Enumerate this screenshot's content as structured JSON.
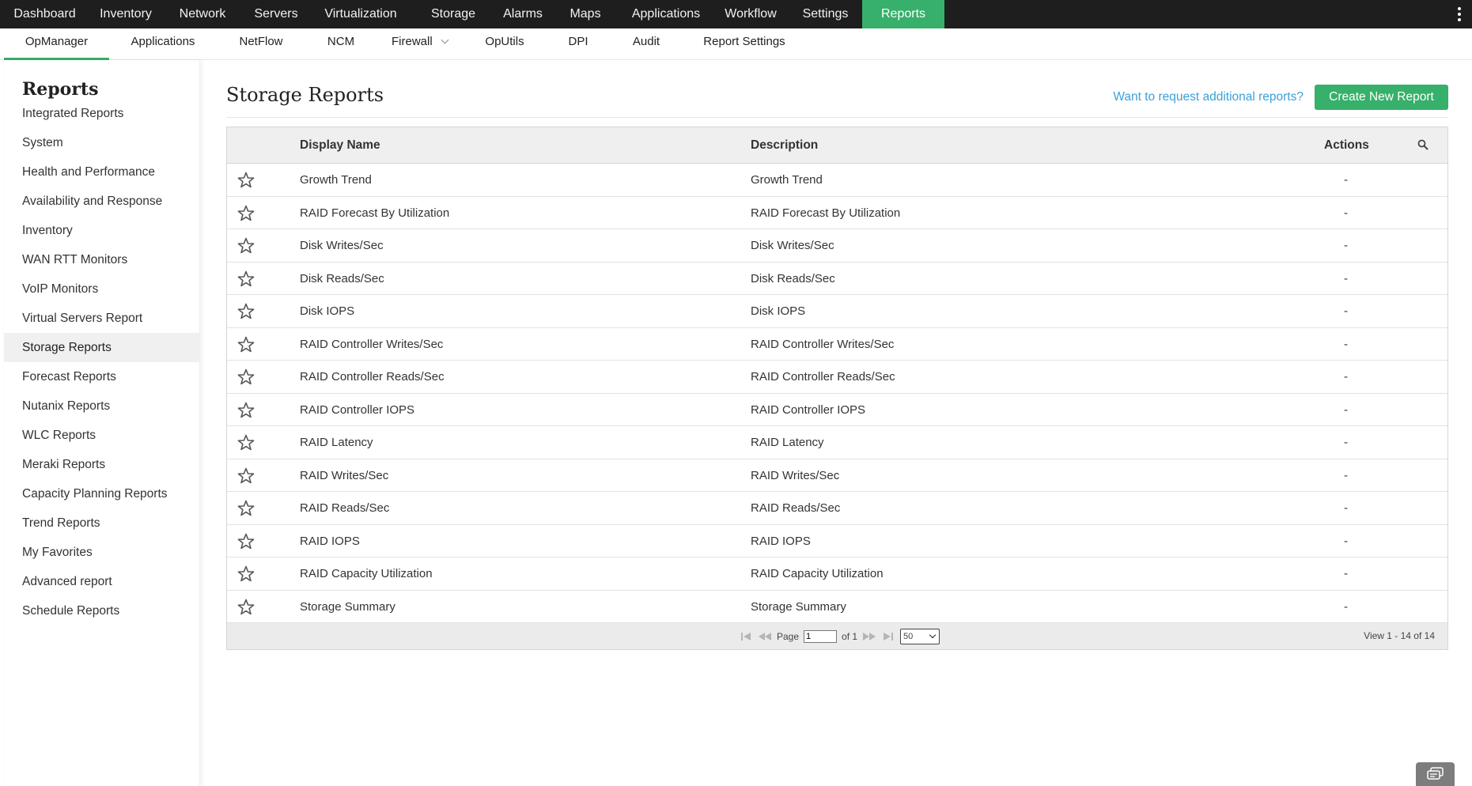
{
  "topnav": {
    "items": [
      {
        "label": "Dashboard"
      },
      {
        "label": "Inventory"
      },
      {
        "label": "Network"
      },
      {
        "label": "Servers"
      },
      {
        "label": "Virtualization"
      },
      {
        "label": "Storage"
      },
      {
        "label": "Alarms"
      },
      {
        "label": "Maps"
      },
      {
        "label": "Applications"
      },
      {
        "label": "Workflow"
      },
      {
        "label": "Settings"
      },
      {
        "label": "Reports"
      }
    ],
    "active": "Reports"
  },
  "subnav": {
    "items": [
      {
        "label": "OpManager"
      },
      {
        "label": "Applications"
      },
      {
        "label": "NetFlow"
      },
      {
        "label": "NCM"
      },
      {
        "label": "Firewall"
      },
      {
        "label": "OpUtils"
      },
      {
        "label": "DPI"
      },
      {
        "label": "Audit"
      },
      {
        "label": "Report Settings"
      }
    ],
    "active": "OpManager"
  },
  "sidebar": {
    "title": "Reports",
    "items": [
      {
        "label": "Integrated Reports"
      },
      {
        "label": "System"
      },
      {
        "label": "Health and Performance"
      },
      {
        "label": "Availability and Response"
      },
      {
        "label": "Inventory"
      },
      {
        "label": "WAN RTT Monitors"
      },
      {
        "label": "VoIP Monitors"
      },
      {
        "label": "Virtual Servers Report"
      },
      {
        "label": "Storage Reports"
      },
      {
        "label": "Forecast Reports"
      },
      {
        "label": "Nutanix Reports"
      },
      {
        "label": "WLC Reports"
      },
      {
        "label": "Meraki Reports"
      },
      {
        "label": "Capacity Planning Reports"
      },
      {
        "label": "Trend Reports"
      },
      {
        "label": "My Favorites"
      },
      {
        "label": "Advanced report"
      },
      {
        "label": "Schedule Reports"
      }
    ],
    "active": "Storage Reports"
  },
  "main": {
    "title": "Storage Reports",
    "request_link": "Want to request additional reports?",
    "create_button": "Create New Report",
    "table": {
      "columns": {
        "name": "Display Name",
        "description": "Description",
        "actions": "Actions"
      },
      "rows": [
        {
          "name": "Growth Trend",
          "description": "Growth Trend",
          "actions": "-"
        },
        {
          "name": "RAID Forecast By Utilization",
          "description": "RAID Forecast By Utilization",
          "actions": "-"
        },
        {
          "name": "Disk Writes/Sec",
          "description": "Disk Writes/Sec",
          "actions": "-"
        },
        {
          "name": "Disk Reads/Sec",
          "description": "Disk Reads/Sec",
          "actions": "-"
        },
        {
          "name": "Disk IOPS",
          "description": "Disk IOPS",
          "actions": "-"
        },
        {
          "name": "RAID Controller Writes/Sec",
          "description": "RAID Controller Writes/Sec",
          "actions": "-"
        },
        {
          "name": "RAID Controller Reads/Sec",
          "description": "RAID Controller Reads/Sec",
          "actions": "-"
        },
        {
          "name": "RAID Controller IOPS",
          "description": "RAID Controller IOPS",
          "actions": "-"
        },
        {
          "name": "RAID Latency",
          "description": "RAID Latency",
          "actions": "-"
        },
        {
          "name": "RAID Writes/Sec",
          "description": "RAID Writes/Sec",
          "actions": "-"
        },
        {
          "name": "RAID Reads/Sec",
          "description": "RAID Reads/Sec",
          "actions": "-"
        },
        {
          "name": "RAID IOPS",
          "description": "RAID IOPS",
          "actions": "-"
        },
        {
          "name": "RAID Capacity Utilization",
          "description": "RAID Capacity Utilization",
          "actions": "-"
        },
        {
          "name": "Storage Summary",
          "description": "Storage Summary",
          "actions": "-"
        }
      ]
    },
    "pager": {
      "page_label": "Page",
      "page_value": "1",
      "of_label": "of 1",
      "page_size": "50",
      "view_info": "View 1 - 14 of 14"
    }
  },
  "colors": {
    "accent": "#36b06a",
    "topnav_bg": "#1e1e1e",
    "link": "#3aa0d8"
  },
  "icons": {
    "row_favorite": "star-outline-icon",
    "table_search": "search-icon",
    "more": "kebab-menu-icon",
    "chat": "chat-icon"
  }
}
